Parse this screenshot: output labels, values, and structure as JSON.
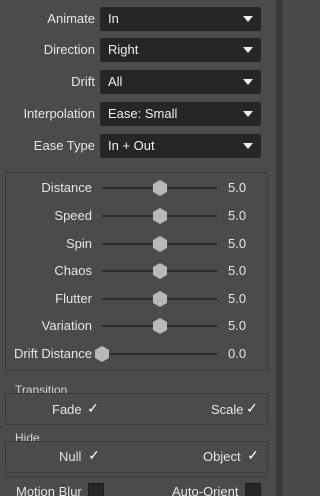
{
  "dropdowns": [
    {
      "label": "Animate",
      "value": "In"
    },
    {
      "label": "Direction",
      "value": "Right"
    },
    {
      "label": "Drift",
      "value": "All"
    },
    {
      "label": "Interpolation",
      "value": "Ease: Small"
    },
    {
      "label": "Ease Type",
      "value": "In + Out"
    }
  ],
  "sliders": [
    {
      "label": "Distance",
      "value": "5.0",
      "level": 0.5
    },
    {
      "label": "Speed",
      "value": "5.0",
      "level": 0.5
    },
    {
      "label": "Spin",
      "value": "5.0",
      "level": 0.5
    },
    {
      "label": "Chaos",
      "value": "5.0",
      "level": 0.5
    },
    {
      "label": "Flutter",
      "value": "5.0",
      "level": 0.5
    },
    {
      "label": "Variation",
      "value": "5.0",
      "level": 0.5
    },
    {
      "label": "Drift Distance",
      "value": "0.0",
      "level": 0.0
    }
  ],
  "transition": {
    "title": "Transition",
    "fade_label": "Fade",
    "fade_checked": "✓",
    "scale_label": "Scale",
    "scale_checked": "✓"
  },
  "hide": {
    "title": "Hide",
    "null_label": "Null",
    "null_checked": "✓",
    "object_label": "Object",
    "object_checked": "✓"
  },
  "footer": {
    "motion_blur_label": "Motion Blur",
    "auto_orient_label": "Auto-Orient"
  },
  "colors": {
    "panel": "#4b4b4b",
    "field": "#262626",
    "text": "#e6e6e6",
    "thumb": "#b8b8b8"
  },
  "icons": {
    "dropdown_caret": "caret-down-icon",
    "slider_thumb": "slider-thumb-icon",
    "check": "checkmark-icon"
  }
}
